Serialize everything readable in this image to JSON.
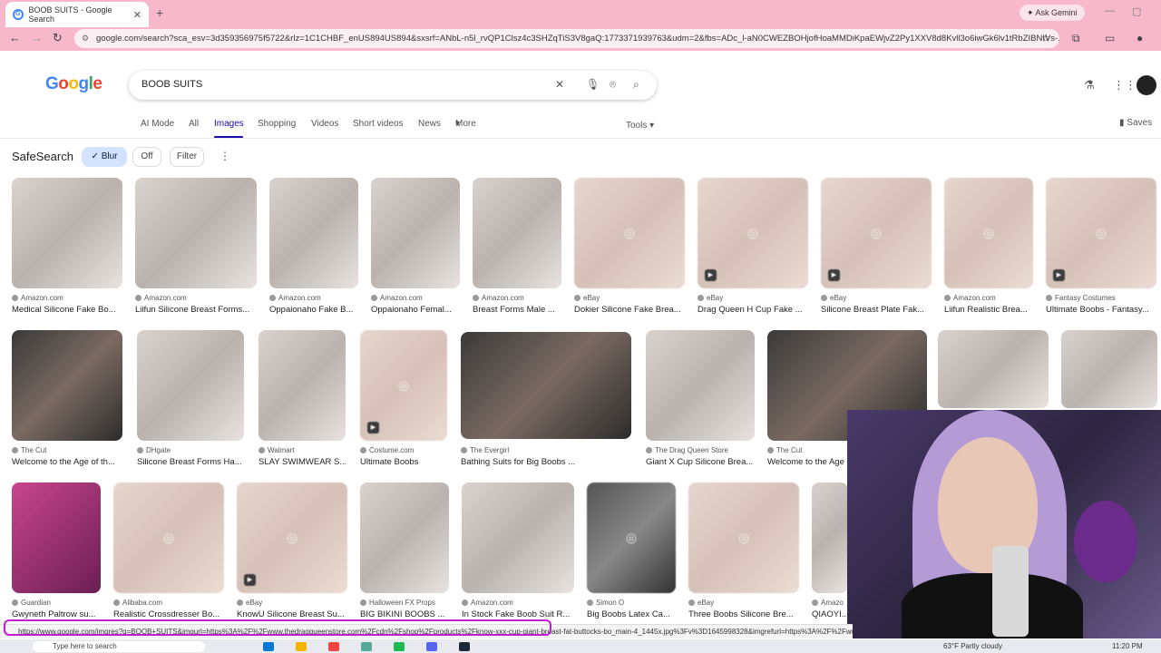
{
  "browser": {
    "tab_title": "BOOB SUITS - Google Search",
    "new_tab": "+",
    "tab_close": "✕",
    "ask_gemini": "Ask Gemini",
    "url": "google.com/search?sca_esv=3d359356975f5722&rlz=1C1CHBF_enUS894US894&sxsrf=ANbL-n5l_rvQP1Clsz4c3SHZqTiS3V8gaQ:1773371939763&udm=2&fbs=ADc_l-aN0CWEZBOHjofHoaMMDiKpaEWjvZ2Py1XXV8d8Kvll3o6iwGk6lv1tRbZIBNIVs-...",
    "status_url": "https://www.google.com/imgres?q=BOOB+SUITS&imgurl=https%3A%2F%2Fwww.thedragqueenstore.com%2Fcdn%2Fshop%2Fproducts%2Fknow-xxx-cup-giant-breast-fat-buttocks-bo_main-4_1445x.jpg%3Fv%3D1645998328&imgrefurl=https%3A%2F%2Fwww"
  },
  "google": {
    "logo": [
      "G",
      "o",
      "o",
      "g",
      "l",
      "e"
    ],
    "query": "BOOB SUITS",
    "tabs": [
      "AI Mode",
      "All",
      "Images",
      "Shopping",
      "Videos",
      "Short videos",
      "News",
      "More"
    ],
    "active_tab": "Images",
    "tools": "Tools",
    "saves": "Saves",
    "safesearch": "SafeSearch",
    "chips": [
      "Blur",
      "Off",
      "Filter"
    ]
  },
  "results": {
    "row1": [
      {
        "source": "Amazon.com",
        "title": "Medical Silicone Fake Bo..."
      },
      {
        "source": "Amazon.com",
        "title": "Liifun Silicone Breast Forms..."
      },
      {
        "source": "Amazon.com",
        "title": "Oppaionaho Fake B..."
      },
      {
        "source": "Amazon.com",
        "title": "Oppaionaho Femal..."
      },
      {
        "source": "Amazon.com",
        "title": "Breast Forms Male ..."
      },
      {
        "source": "eBay",
        "title": "Dokier Silicone Fake Brea..."
      },
      {
        "source": "eBay",
        "title": "Drag Queen H Cup Fake ..."
      },
      {
        "source": "eBay",
        "title": "Silicone Breast Plate Fak..."
      },
      {
        "source": "Amazon.com",
        "title": "Liifun Realistic Brea..."
      },
      {
        "source": "Fantasy Costumes",
        "title": "Ultimate Boobs - Fantasy..."
      }
    ],
    "row2": [
      {
        "source": "The Cut",
        "title": "Welcome to the Age of th..."
      },
      {
        "source": "DHgate",
        "title": "Silicone Breast Forms Ha..."
      },
      {
        "source": "Walmart",
        "title": "SLAY SWIMWEAR S..."
      },
      {
        "source": "Costume.com",
        "title": "Ultimate Boobs"
      },
      {
        "source": "The Evergirl",
        "title": "Bathing Suits for Big Boobs ..."
      },
      {
        "source": "The Drag Queen Store",
        "title": "Giant X Cup Silicone Brea..."
      },
      {
        "source": "The Cut",
        "title": "Welcome to the Age"
      }
    ],
    "row3": [
      {
        "source": "Guardian",
        "title": "Gwyneth Paltrow su..."
      },
      {
        "source": "Alibaba.com",
        "title": "Realistic Crossdresser Bo..."
      },
      {
        "source": "eBay",
        "title": "KnowU Silicone Breast Su..."
      },
      {
        "source": "Halloween FX Props",
        "title": "BIG BIKINI BOOBS ..."
      },
      {
        "source": "Amazon.com",
        "title": "In Stock Fake Boob Suit R..."
      },
      {
        "source": "Simon O",
        "title": "Big Boobs Latex Ca..."
      },
      {
        "source": "eBay",
        "title": "Three Boobs Silicone Bre..."
      },
      {
        "source": "Amazo",
        "title": "QIAOYI..."
      }
    ]
  },
  "taskbar": {
    "search": "Type here to search",
    "weather": "63°F  Partly cloudy",
    "time": "11:20 PM"
  }
}
